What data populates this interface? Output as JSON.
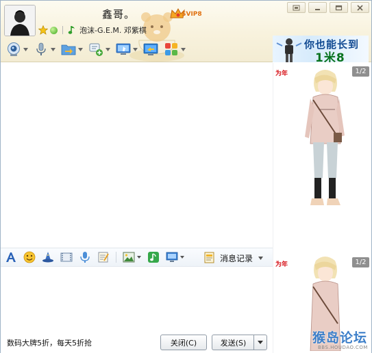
{
  "contact": {
    "nickname": "鑫哥。",
    "svip_label": "SVIP8",
    "now_playing": "泡沫-G.E.M. 邓紫棋"
  },
  "banner": {
    "line1": "你也能长到",
    "line2": "1米8"
  },
  "window_controls": [
    "skin-icon",
    "minimize-icon",
    "maximize-icon",
    "close-icon"
  ],
  "toolbar": {
    "items": [
      {
        "name": "video-call",
        "icon": "webcam-icon"
      },
      {
        "name": "voice-call",
        "icon": "microphone-icon"
      },
      {
        "name": "send-file",
        "icon": "folder-transfer-icon"
      },
      {
        "name": "create-discussion",
        "icon": "chat-add-icon"
      },
      {
        "name": "remote-assist",
        "icon": "remote-desktop-icon"
      },
      {
        "name": "share-screen",
        "icon": "screen-share-icon"
      },
      {
        "name": "apps",
        "icon": "apps-grid-icon"
      }
    ]
  },
  "edit_toolbar": {
    "history_label": "消息记录",
    "items": [
      "font-icon",
      "emoji-icon",
      "magic-icon",
      "video-clip-icon",
      "voice-message-icon",
      "note-icon",
      "image-icon",
      "music-icon",
      "screenshot-icon"
    ]
  },
  "footer": {
    "ad_text": "数码大牌5折，每天5折抢",
    "close_label": "关闭(C)",
    "send_label": "发送(S)"
  },
  "side": {
    "badge": "为年",
    "pager_top": "1/2",
    "pager_bottom": "1/2"
  },
  "watermark": {
    "main": "猴岛论坛",
    "sub": "BBS.HOUDAO.COM"
  },
  "colors": {
    "header_bg": "#f8f2dd",
    "accent_blue": "#3d7fc9",
    "svip_orange": "#e07010"
  }
}
